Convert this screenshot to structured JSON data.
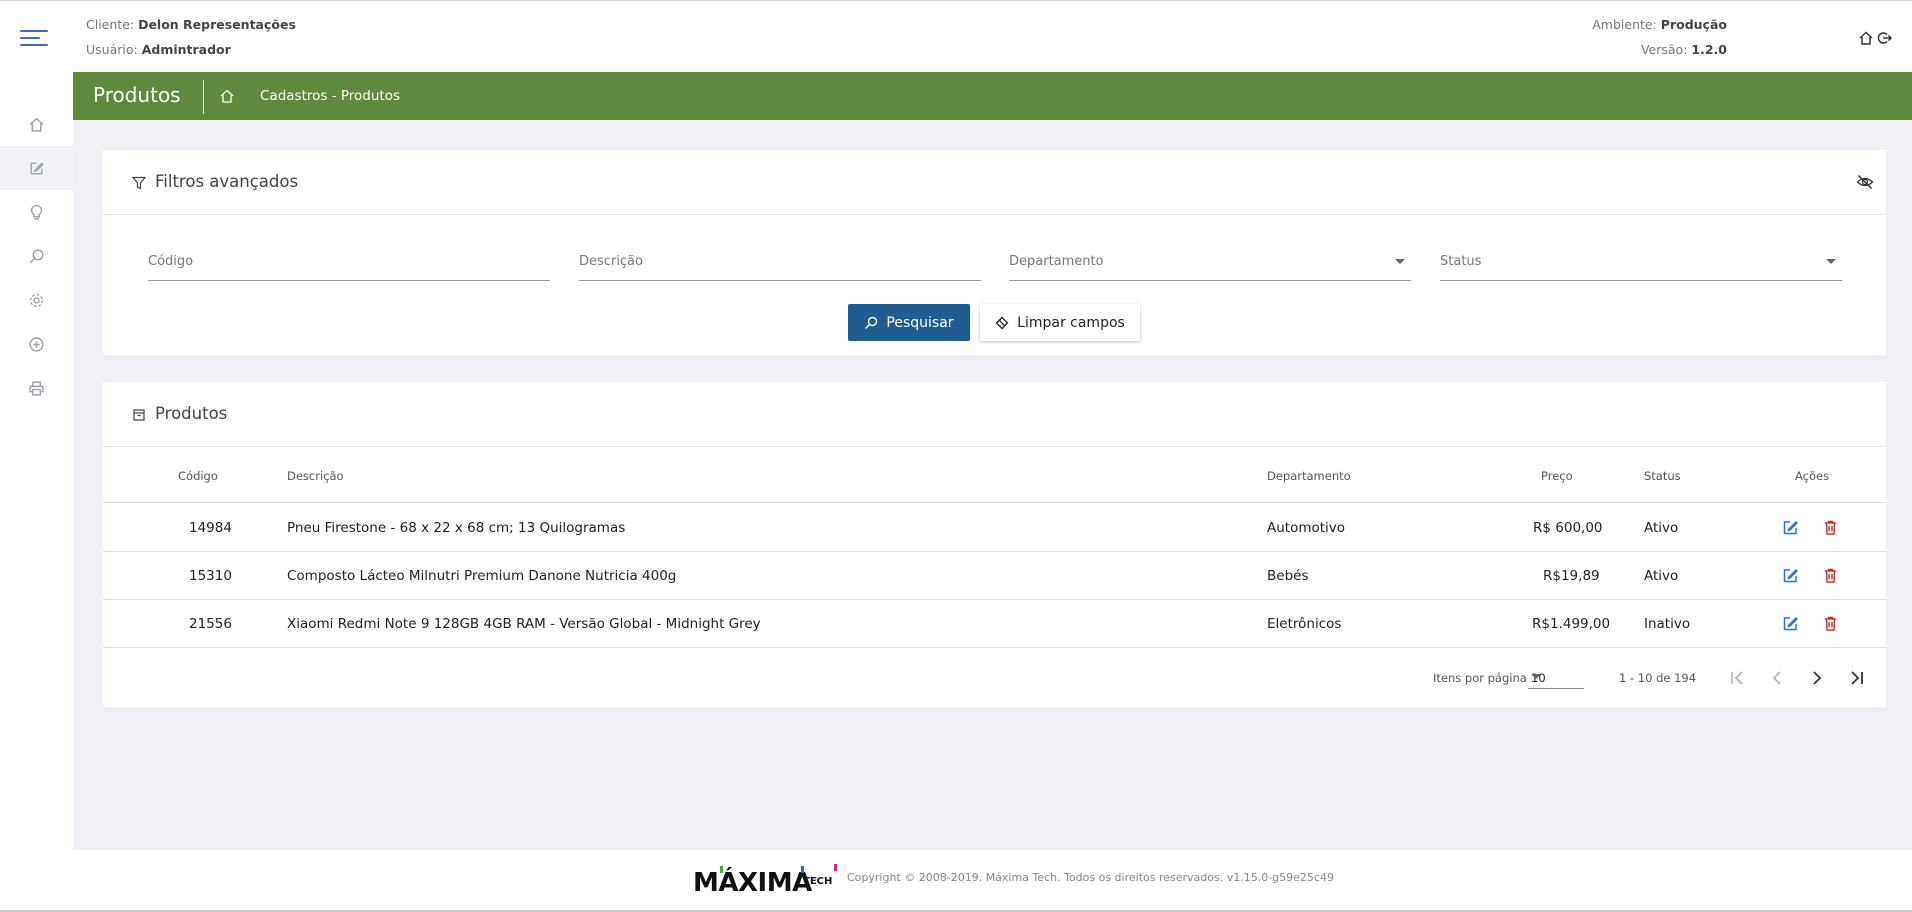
{
  "header": {
    "client_label": "Cliente:",
    "client_value": "Delon Representações",
    "user_label": "Usuário:",
    "user_value": "Admintrador",
    "env_label": "Ambiente:",
    "env_value": "Produção",
    "version_label": "Versão:",
    "version_value": "1.2.0"
  },
  "sidebar": {
    "items": [
      "home-icon",
      "edit-icon",
      "lightbulb-icon",
      "search-icon",
      "gear-icon",
      "add-circle-icon",
      "printer-icon"
    ],
    "active_index": 1
  },
  "banner": {
    "title": "Produtos",
    "breadcrumb": "Cadastros - Produtos",
    "color": "#5f8a3e"
  },
  "filters": {
    "title": "Filtros avançados",
    "fields": {
      "codigo": "Código",
      "descricao": "Descrição",
      "departamento": "Departamento",
      "status": "Status"
    },
    "search_label": "Pesquisar",
    "clear_label": "Limpar campos",
    "search_color": "#1f5c91"
  },
  "products": {
    "title": "Produtos",
    "columns": {
      "codigo": "Código",
      "descricao": "Descrição",
      "departamento": "Departamento",
      "preco": "Preço",
      "status": "Status",
      "acoes": "Ações"
    },
    "rows": [
      {
        "codigo": "14984",
        "descricao": "Pneu Firestone - 68 x 22 x 68 cm; 13 Quilogramas",
        "departamento": "Automotivo",
        "preco": "R$ 600,00",
        "status": "Ativo"
      },
      {
        "codigo": "15310",
        "descricao": "Composto Lácteo Milnutri Premium Danone Nutricia 400g",
        "departamento": "Bebés",
        "preco": "R$19,89",
        "status": "Ativo"
      },
      {
        "codigo": "21556",
        "descricao": "Xiaomi Redmi Note 9 128GB 4GB RAM - Versão Global - Midnight Grey",
        "departamento": "Eletrônicos",
        "preco": "R$1.499,00",
        "status": "Inativo"
      }
    ],
    "pager": {
      "items_per_page_label": "Itens por página",
      "items_per_page_value": "10",
      "range": "1 - 10 de 194"
    }
  },
  "footer": {
    "logo_text": "MÁXIMA",
    "logo_suffix": "TECH",
    "copyright": "Copyright © 2008-2019. Máxima Tech. Todos os direitos reservados. v1.15.0-g59e25c49"
  }
}
